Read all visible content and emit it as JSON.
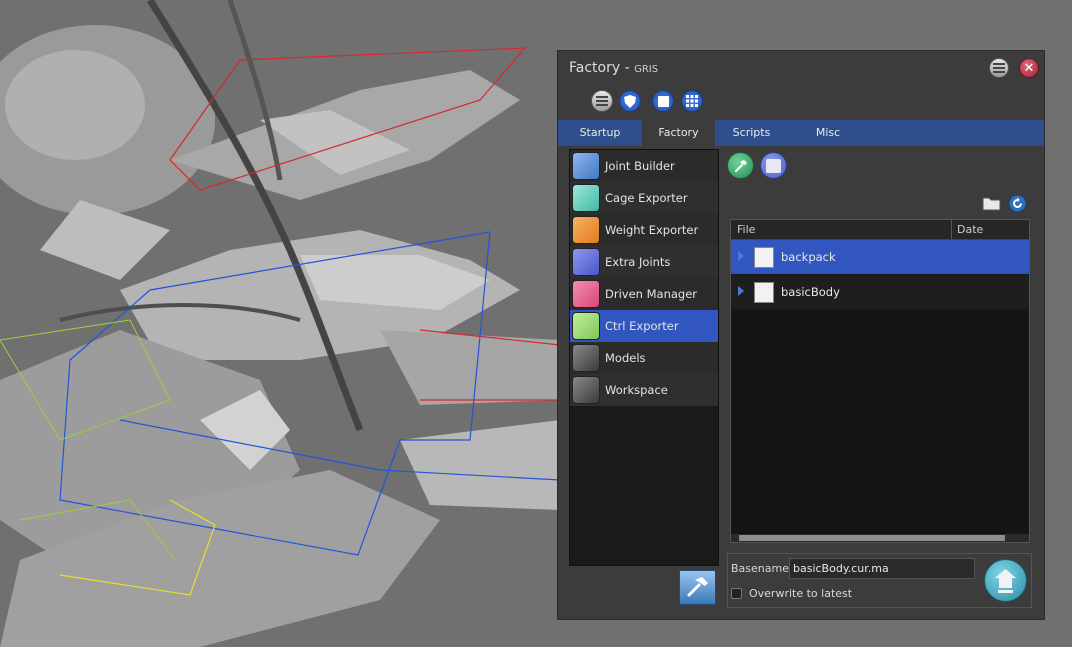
{
  "window": {
    "title": "Factory - ",
    "title_sub": "GRIS"
  },
  "toolbar": {
    "icons": [
      "list-icon",
      "shield-icon",
      "square-icon",
      "grid-icon"
    ]
  },
  "tabs": [
    {
      "label": "Startup",
      "active": false
    },
    {
      "label": "Factory",
      "active": true
    },
    {
      "label": "Scripts",
      "active": false
    },
    {
      "label": "Misc",
      "active": false
    }
  ],
  "tools": [
    {
      "label": "Joint Builder",
      "icon": "joint-builder-icon",
      "color": "#3f79c6",
      "selected": false
    },
    {
      "label": "Cage Exporter",
      "icon": "cage-exporter-icon",
      "color": "#3fb9a6",
      "selected": false
    },
    {
      "label": "Weight Exporter",
      "icon": "weight-exporter-icon",
      "color": "#e07a20",
      "selected": false
    },
    {
      "label": "Extra Joints",
      "icon": "extra-joints-icon",
      "color": "#4a56c8",
      "selected": false
    },
    {
      "label": "Driven Manager",
      "icon": "driven-manager-icon",
      "color": "#d9477a",
      "selected": false
    },
    {
      "label": "Ctrl Exporter",
      "icon": "ctrl-exporter-icon",
      "color": "#7dc85a",
      "selected": true
    },
    {
      "label": "Models",
      "icon": "models-script-icon",
      "color": "#505050",
      "selected": false
    },
    {
      "label": "Workspace",
      "icon": "workspace-script-icon",
      "color": "#505050",
      "selected": false
    }
  ],
  "file_table": {
    "columns": [
      "File",
      "Date"
    ],
    "rows": [
      {
        "name": "backpack",
        "date": "",
        "selected": true
      },
      {
        "name": "basicBody",
        "date": "",
        "selected": false
      }
    ]
  },
  "export": {
    "basename_label": "Basename",
    "basename_value": "basicBody.cur.ma",
    "overwrite_label": "Overwrite to latest",
    "overwrite_checked": false
  },
  "colors": {
    "tab_bar": "#2f4f8c",
    "selection": "#3156c0",
    "panel": "#3c3c3c"
  }
}
